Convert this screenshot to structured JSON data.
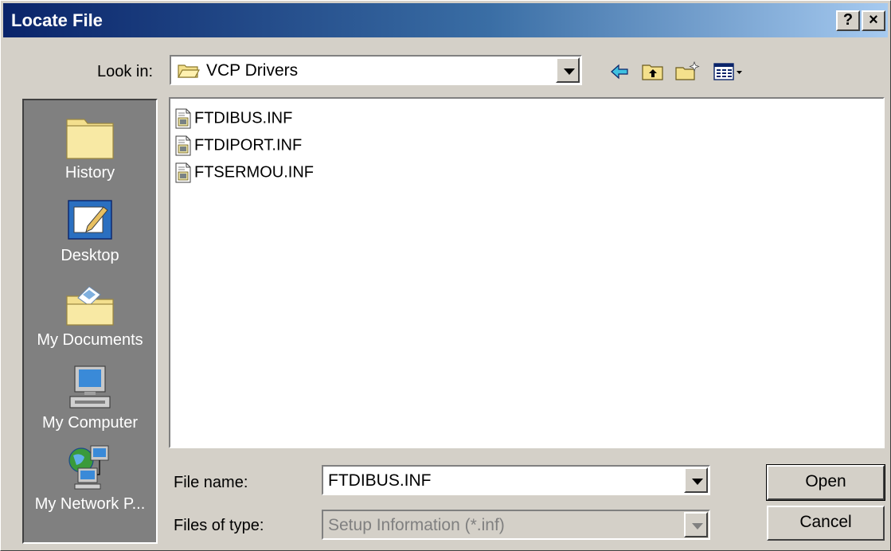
{
  "window": {
    "title": "Locate File",
    "help_label": "?",
    "close_label": "×"
  },
  "look_in": {
    "label": "Look in:",
    "value": "VCP Drivers",
    "folder_icon": "open-folder-icon"
  },
  "toolbar": {
    "back_icon": "back-arrow-icon",
    "up_icon": "up-one-level-icon",
    "new_folder_icon": "new-folder-icon",
    "view_icon": "view-menu-icon"
  },
  "places": [
    {
      "label": "History",
      "icon": "history-icon"
    },
    {
      "label": "Desktop",
      "icon": "desktop-icon"
    },
    {
      "label": "My Documents",
      "icon": "my-documents-icon"
    },
    {
      "label": "My Computer",
      "icon": "my-computer-icon"
    },
    {
      "label": "My Network P...",
      "icon": "my-network-places-icon"
    }
  ],
  "files": [
    {
      "name": "FTDIBUS.INF",
      "icon": "inf-file-icon"
    },
    {
      "name": "FTDIPORT.INF",
      "icon": "inf-file-icon"
    },
    {
      "name": "FTSERMOU.INF",
      "icon": "inf-file-icon"
    }
  ],
  "file_name": {
    "label": "File name:",
    "value": "FTDIBUS.INF"
  },
  "file_type": {
    "label": "Files of type:",
    "value": "Setup Information (*.inf)"
  },
  "buttons": {
    "open": "Open",
    "cancel": "Cancel"
  }
}
